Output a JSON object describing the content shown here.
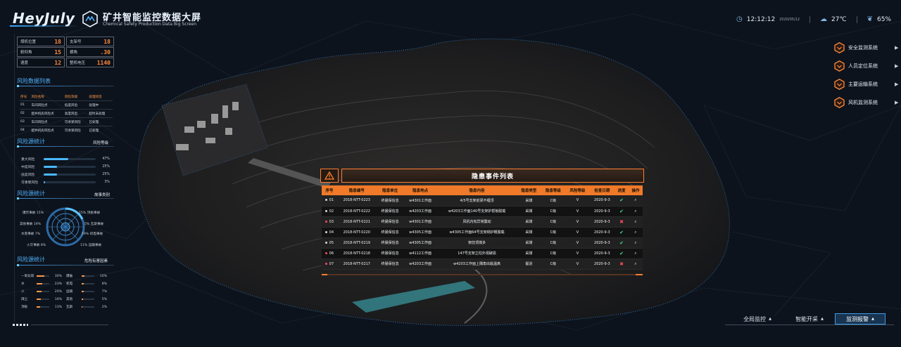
{
  "header": {
    "logo": "HeyJuly",
    "title": "矿井智能监控数据大屏",
    "subtitle": "Chemical Safety Production Data Big Screen",
    "time": "12:12:12",
    "date": "2020/05/12",
    "temperature": "27℃",
    "humidity": "65%"
  },
  "stats": [
    {
      "label": "煤机位置",
      "value": "18"
    },
    {
      "label": "支架号",
      "value": "18"
    },
    {
      "label": "俯仰角",
      "value": "15"
    },
    {
      "label": "横角",
      "value": ".30"
    },
    {
      "label": "速度",
      "value": "12"
    },
    {
      "label": "整机电压",
      "value": "1140"
    }
  ],
  "risk_list": {
    "title": "风险数据列表",
    "columns": [
      "序号",
      "风险名称",
      "风险等级",
      "处理状态"
    ],
    "rows": [
      [
        "01",
        "车间风险点",
        "低度风险",
        "处理中"
      ],
      [
        "02",
        "配并机房风险点",
        "高度风险",
        "超时未处理"
      ],
      [
        "03",
        "车间风险点",
        "可承受风险",
        "已处理"
      ],
      [
        "04",
        "配并机房风险点",
        "可承受风险",
        "已处理"
      ]
    ]
  },
  "risk_source_level": {
    "title": "风险源统计",
    "right": "风险等级",
    "items": [
      {
        "label": "重大风险",
        "value": 47,
        "text": "47%"
      },
      {
        "label": "中度风险",
        "value": 25,
        "text": "25%"
      },
      {
        "label": "低度风险",
        "value": 25,
        "text": "25%"
      },
      {
        "label": "可承受风险",
        "value": 3,
        "text": "3%"
      }
    ]
  },
  "risk_source_accident": {
    "title": "风险源统计",
    "right": "故事类别",
    "left_labels": [
      {
        "label": "爆炸事故",
        "value": "15%"
      },
      {
        "label": "其他事故",
        "value": "19%"
      },
      {
        "label": "水害事故",
        "value": "7%"
      },
      {
        "label": "火灾事故",
        "value": "8%"
      }
    ],
    "right_labels": [
      {
        "label": "顶板事故",
        "value": "15%"
      },
      {
        "label": "瓦斯事故",
        "value": "5%"
      },
      {
        "label": "机电事故",
        "value": "19%"
      },
      {
        "label": "运输事故",
        "value": "11%"
      }
    ]
  },
  "risk_source_factor": {
    "title": "风险源统计",
    "right": "危险有害因素",
    "left": [
      {
        "label": "—氧化碳",
        "value": 30,
        "text": "30%"
      },
      {
        "label": "水",
        "value": 23,
        "text": "23%"
      },
      {
        "label": "火",
        "value": 20,
        "text": "20%"
      },
      {
        "label": "煤尘",
        "value": 16,
        "text": "16%"
      },
      {
        "label": "顶板",
        "value": 13,
        "text": "13%"
      }
    ],
    "right_items": [
      {
        "label": "爆破",
        "value": 10,
        "text": "10%"
      },
      {
        "label": "机电",
        "value": 8,
        "text": "8%"
      },
      {
        "label": "运输",
        "value": 7,
        "text": "7%"
      },
      {
        "label": "其他",
        "value": 5,
        "text": "5%"
      },
      {
        "label": "瓦斯",
        "value": 2,
        "text": "2%"
      }
    ]
  },
  "systems": [
    {
      "label": "安全监测系统"
    },
    {
      "label": "人员定位系统"
    },
    {
      "label": "主要运输系统"
    },
    {
      "label": "风机监测系统"
    }
  ],
  "bottom_nav": [
    {
      "label": "全局监控",
      "active": false
    },
    {
      "label": "智能开采",
      "active": false
    },
    {
      "label": "监测报警",
      "active": true
    }
  ],
  "events": {
    "title": "隐患事件列表",
    "columns": [
      "序号",
      "隐患编号",
      "隐患单位",
      "隐患地点",
      "隐患内容",
      "隐患类型",
      "隐患等级",
      "风险等级",
      "检查日期",
      "进度",
      "操作"
    ],
    "rows": [
      {
        "no": "01",
        "id": "2018-NTT-0223",
        "unit": "终晨保信息",
        "place": "w4301工作面",
        "content": "4/5号支架前梁不缠顶",
        "type": "采煤",
        "level": "C级",
        "risk": "V",
        "date": "2020-9-3",
        "ok": true,
        "dot": "#cfd8e3"
      },
      {
        "no": "02",
        "id": "2018-NTT-0222",
        "unit": "终晨保信息",
        "place": "w4203工作面",
        "content": "w4203工作面140号支架护帮板脱载",
        "type": "采煤",
        "level": "C级",
        "risk": "V",
        "date": "2020-9-3",
        "ok": true,
        "dot": "#cfd8e3"
      },
      {
        "no": "03",
        "id": "2018-NTT-0221",
        "unit": "终晨保信息",
        "place": "w4301工作面",
        "content": "风机内有异常震动",
        "type": "采煤",
        "level": "C级",
        "risk": "V",
        "date": "2020-9-3",
        "ok": false,
        "dot": "#ff4a5a"
      },
      {
        "no": "04",
        "id": "2018-NTT-0220",
        "unit": "终晨保信息",
        "place": "w4305工作面",
        "content": "w4305工作面64号支架锅炉概脱载",
        "type": "采煤",
        "level": "C级",
        "risk": "V",
        "date": "2020-9-3",
        "ok": true,
        "dot": "#cfd8e3"
      },
      {
        "no": "05",
        "id": "2018-NTT-0219",
        "unit": "终晨保信息",
        "place": "w4305工作面",
        "content": "架前顶煤多",
        "type": "采煤",
        "level": "C级",
        "risk": "V",
        "date": "2020-9-3",
        "ok": true,
        "dot": "#cfd8e3"
      },
      {
        "no": "06",
        "id": "2018-NTT-0218",
        "unit": "终晨保信息",
        "place": "w4112工作面",
        "content": "147号支架立柱外观破损",
        "type": "采煤",
        "level": "C级",
        "risk": "V",
        "date": "2020-9-3",
        "ok": true,
        "dot": "#ff4a5a"
      },
      {
        "no": "07",
        "id": "2018-NTT-0217",
        "unit": "终晨保信息",
        "place": "w4203工作面",
        "content": "w4203工作面上隅角出敌温髙",
        "type": "掘进",
        "level": "C级",
        "risk": "V",
        "date": "2020-9-3",
        "ok": false,
        "dot": "#ff4a5a"
      }
    ]
  },
  "colors": {
    "accent": "#4eb3ff",
    "warning": "#ff7d2e",
    "ok": "#3fe08a",
    "danger": "#ff4a5a"
  }
}
